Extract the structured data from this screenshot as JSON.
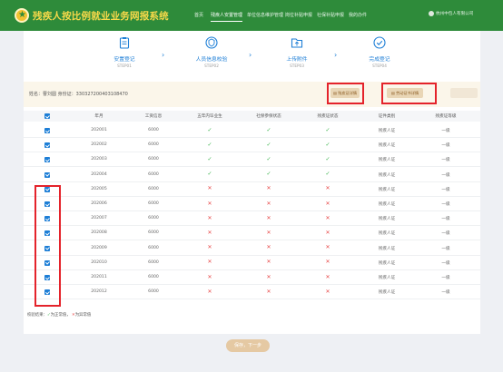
{
  "header": {
    "app_title": "残疾人按比例就业业务网报系统",
    "nav": [
      "首页",
      "残疾人安置管理",
      "单位信息维护管理",
      "岗位补贴申报",
      "社保补贴申报",
      "我的办件"
    ],
    "active_nav_index": 1,
    "user": "杭州中包人有限公司"
  },
  "steps": [
    {
      "title": "安置登记",
      "sub": "STEP01"
    },
    {
      "title": "人员信息校验",
      "sub": "STEP02"
    },
    {
      "title": "上传附件",
      "sub": "STEP03"
    },
    {
      "title": "完成登记",
      "sub": "STEP04"
    }
  ],
  "info": {
    "text": "姓名：曹刘圆  身份证：330327200403108470",
    "btn_disability_cert": "残疾证详情",
    "btn_employment_cert": "劳动证书详情"
  },
  "table": {
    "headers": [
      "",
      "年月",
      "工资信息",
      "五年内毕业生",
      "社保参保状态",
      "残疾证状态",
      "证件类别",
      "残疾证等级"
    ],
    "rows": [
      {
        "month": "202001",
        "wage": "6000",
        "grad": "ok",
        "social": "ok",
        "cert": "ok",
        "type": "残疾人证",
        "level": "一级"
      },
      {
        "month": "202002",
        "wage": "6000",
        "grad": "ok",
        "social": "ok",
        "cert": "ok",
        "type": "残疾人证",
        "level": "一级"
      },
      {
        "month": "202003",
        "wage": "6000",
        "grad": "ok",
        "social": "ok",
        "cert": "ok",
        "type": "残疾人证",
        "level": "一级"
      },
      {
        "month": "202004",
        "wage": "6000",
        "grad": "ok",
        "social": "ok",
        "cert": "ok",
        "type": "残疾人证",
        "level": "一级"
      },
      {
        "month": "202005",
        "wage": "6000",
        "grad": "bad",
        "social": "bad",
        "cert": "bad",
        "type": "残疾人证",
        "level": "一级"
      },
      {
        "month": "202006",
        "wage": "6000",
        "grad": "bad",
        "social": "bad",
        "cert": "bad",
        "type": "残疾人证",
        "level": "一级"
      },
      {
        "month": "202007",
        "wage": "6000",
        "grad": "bad",
        "social": "bad",
        "cert": "bad",
        "type": "残疾人证",
        "level": "一级"
      },
      {
        "month": "202008",
        "wage": "6000",
        "grad": "bad",
        "social": "bad",
        "cert": "bad",
        "type": "残疾人证",
        "level": "一级"
      },
      {
        "month": "202009",
        "wage": "6000",
        "grad": "bad",
        "social": "bad",
        "cert": "bad",
        "type": "残疾人证",
        "level": "一级"
      },
      {
        "month": "202010",
        "wage": "6000",
        "grad": "bad",
        "social": "bad",
        "cert": "bad",
        "type": "残疾人证",
        "level": "一级"
      },
      {
        "month": "202011",
        "wage": "6000",
        "grad": "bad",
        "social": "bad",
        "cert": "bad",
        "type": "残疾人证",
        "level": "一级"
      },
      {
        "month": "202012",
        "wage": "6000",
        "grad": "bad",
        "social": "bad",
        "cert": "bad",
        "type": "残疾人证",
        "level": "一级"
      }
    ]
  },
  "legend": {
    "prefix": "校验结果：",
    "ok_text": "为正常值",
    "bad_text": "为异常值"
  },
  "next_button": "保存，下一步",
  "colors": {
    "header_green": "#2e8b3a",
    "title_gold": "#f7d94a",
    "accent_blue": "#1d7ed6",
    "ok_green": "#38b24a",
    "bad_red": "#e84a4a",
    "highlight_red": "#e4232b"
  }
}
